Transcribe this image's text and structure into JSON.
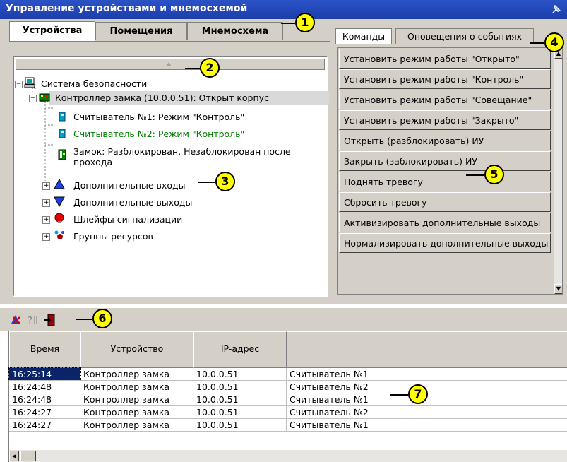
{
  "window": {
    "title": "Управление устройствами и мнемосхемой"
  },
  "left_tabs": [
    "Устройства",
    "Помещения",
    "Мнемосхема"
  ],
  "right_tabs": [
    "Команды",
    "Оповещения о событиях"
  ],
  "tree": [
    {
      "label": "Система безопасности",
      "color": "#000000",
      "icon": "computer-icon",
      "expander": "minus"
    },
    {
      "label": "Контроллер замка (10.0.0.51): Открыт корпус",
      "color": "#000000",
      "icon": "controller-icon",
      "expander": "minus"
    },
    {
      "label": "Считыватель №1: Режим \"Контроль\"",
      "color": "#000000",
      "icon": "reader-icon",
      "expander": ""
    },
    {
      "label": "Считыватель №2: Режим \"Контроль\"",
      "color": "#008000",
      "icon": "reader-icon",
      "expander": ""
    },
    {
      "label": "Замок: Разблокирован, Незаблокирован после",
      "label2": "прохода",
      "color": "#000000",
      "icon": "lock-icon",
      "expander": ""
    },
    {
      "label": "Дополнительные входы",
      "color": "#000000",
      "icon": "inputs-icon",
      "expander": "plus"
    },
    {
      "label": "Дополнительные выходы",
      "color": "#000000",
      "icon": "outputs-icon",
      "expander": "plus"
    },
    {
      "label": "Шлейфы сигнализации",
      "color": "#000000",
      "icon": "alarm-loop-icon",
      "expander": "plus"
    },
    {
      "label": "Группы ресурсов",
      "color": "#000000",
      "icon": "resource-group-icon",
      "expander": "plus"
    }
  ],
  "commands": [
    "Установить режим работы \"Открыто\"",
    "Установить режим работы \"Контроль\"",
    "Установить режим работы \"Совещание\"",
    "Установить режим работы \"Закрыто\"",
    "Открыть (разблокировать) ИУ",
    "Закрыть (заблокировать) ИУ",
    "Поднять тревогу",
    "Сбросить тревогу",
    "Активизировать дополнительные выходы",
    "Нормализировать дополнительные выходы"
  ],
  "events": {
    "columns": [
      "Время",
      "Устройство",
      "IP-адрес",
      ""
    ],
    "rows": [
      [
        "16:25:14",
        "Контроллер замка",
        "10.0.0.51",
        "Считыватель №1"
      ],
      [
        "16:24:48",
        "Контроллер замка",
        "10.0.0.51",
        "Считыватель №2"
      ],
      [
        "16:24:48",
        "Контроллер замка",
        "10.0.0.51",
        "Считыватель №1"
      ],
      [
        "16:24:27",
        "Контроллер замка",
        "10.0.0.51",
        "Считыватель №2"
      ],
      [
        "16:24:27",
        "Контроллер замка",
        "10.0.0.51",
        "Считыватель №1"
      ]
    ],
    "selected_row": 0
  },
  "callouts": [
    "1",
    "2",
    "3",
    "4",
    "5",
    "6",
    "7"
  ],
  "colors": {
    "title_bar": "#2246b8",
    "panel": "#d4d0c8",
    "selection": "#0a246a",
    "callout": "#ffff00"
  }
}
